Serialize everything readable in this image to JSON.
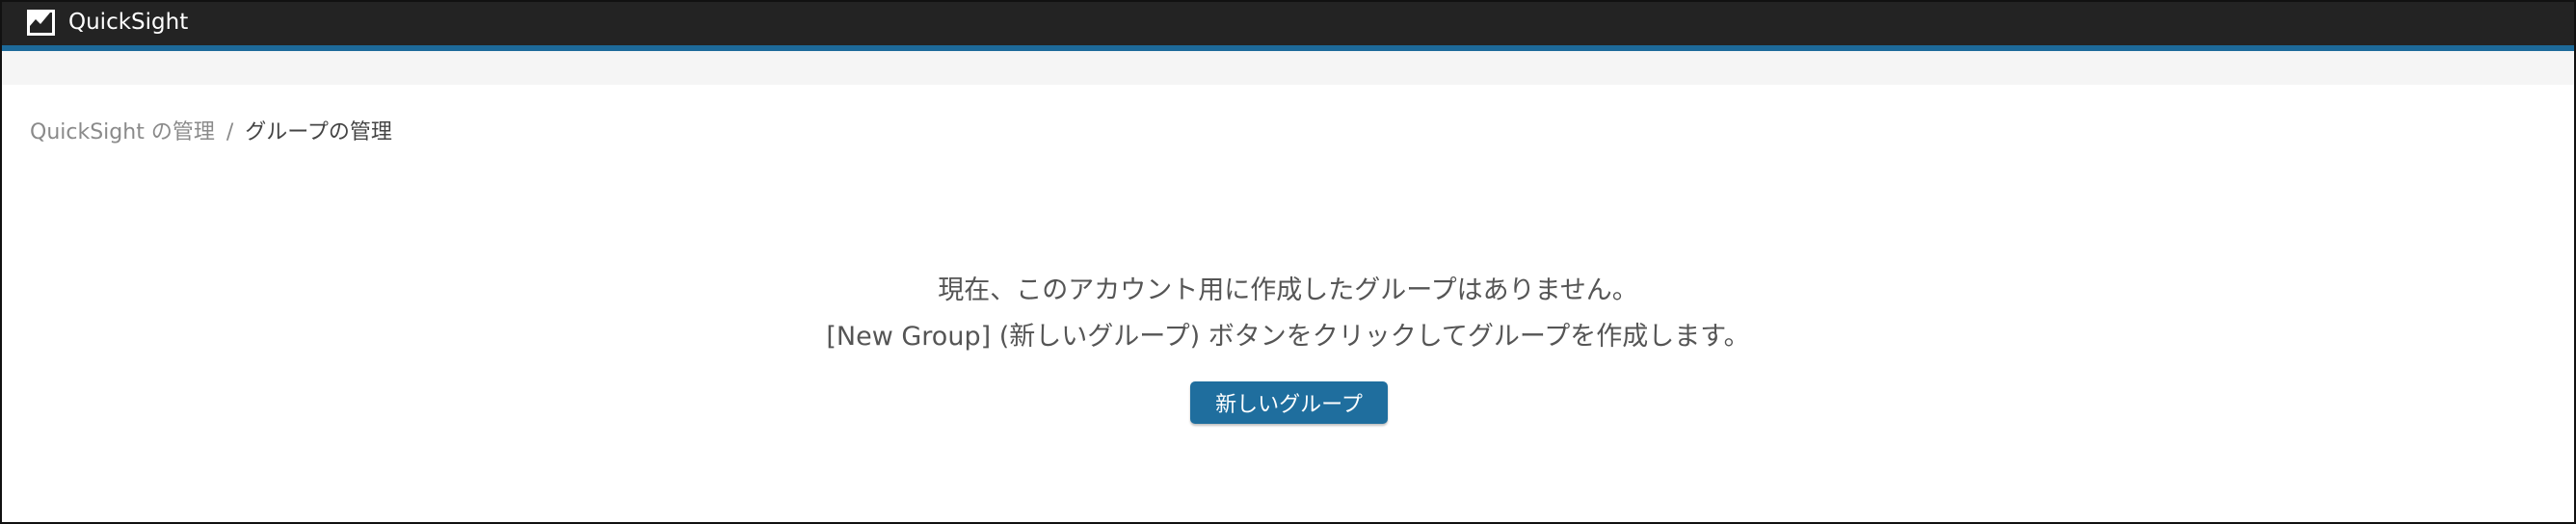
{
  "app": {
    "name": "QuickSight",
    "logo_icon": "chart-area-icon"
  },
  "colors": {
    "topbar": "#232323",
    "accent": "#1d6a9a",
    "button": "#1f6e9e"
  },
  "breadcrumb": {
    "items": [
      {
        "label": "QuickSight の管理",
        "link": true
      },
      {
        "label": "グループの管理",
        "link": false
      }
    ],
    "separator": "/"
  },
  "empty_state": {
    "line1": "現在、このアカウント用に作成したグループはありません。",
    "line2": "[New Group] (新しいグループ) ボタンをクリックしてグループを作成します。",
    "button_label": "新しいグループ"
  }
}
